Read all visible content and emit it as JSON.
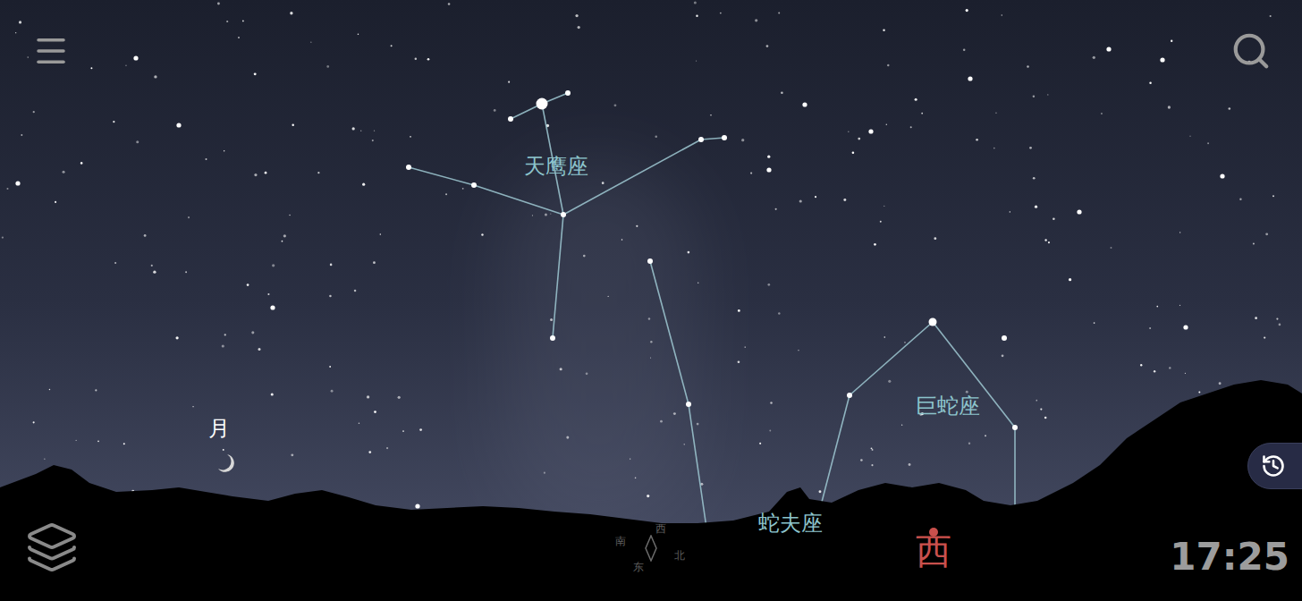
{
  "sky": {
    "constellations": [
      {
        "name": "天鹰座"
      },
      {
        "name": "蛇夫座"
      },
      {
        "name": "巨蛇座"
      }
    ],
    "moon": {
      "label": "月"
    }
  },
  "compass": {
    "labels": [
      "南",
      "西",
      "东",
      "北"
    ]
  },
  "direction": {
    "label": "西"
  },
  "time": "17:25"
}
